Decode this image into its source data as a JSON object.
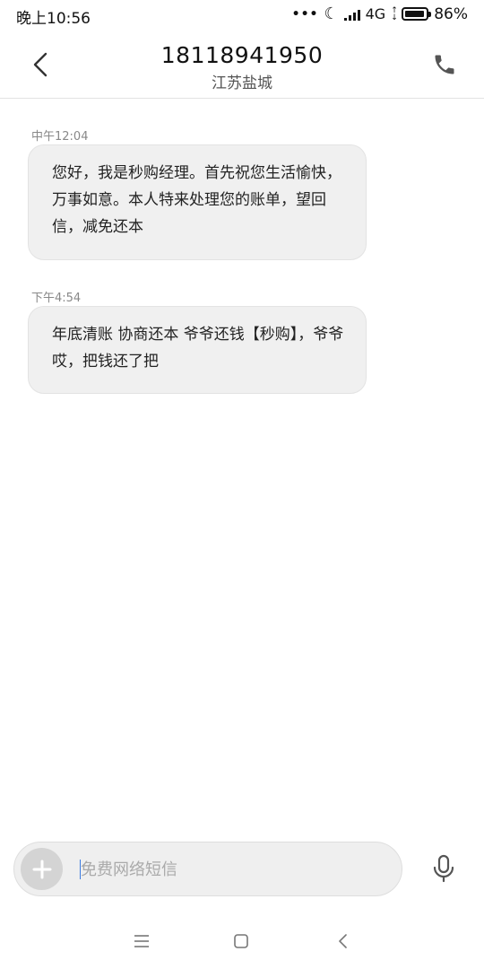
{
  "status_bar": {
    "time": "晚上10:56",
    "dots": "•••",
    "network": "4G",
    "battery_percent": "86%",
    "battery_level": 0.86,
    "icons": [
      "moon-icon",
      "signal-icon",
      "network-arrows-icon",
      "battery-icon"
    ]
  },
  "header": {
    "title": "18118941950",
    "subtitle": "江苏盐城",
    "back_icon": "chevron-left-icon",
    "call_icon": "phone-icon"
  },
  "messages": [
    {
      "time": "中午12:04",
      "text": "您好，我是秒购经理。首先祝您生活愉快，万事如意。本人特来处理您的账单，望回信，减免还本"
    },
    {
      "time": "下午4:54",
      "text": "年底清账 协商还本 爷爷还钱【秒购】，爷爷哎，把钱还了把"
    }
  ],
  "composer": {
    "placeholder": "免费网络短信",
    "value": "",
    "plus_icon": "plus-icon",
    "mic_icon": "microphone-icon"
  },
  "nav_bar": {
    "icons": [
      "menu-icon",
      "home-square-icon",
      "back-chevron-icon"
    ]
  },
  "colors": {
    "bubble_bg": "#f0f0f0",
    "caret": "#3b7be0",
    "icon_gray": "#555555"
  }
}
